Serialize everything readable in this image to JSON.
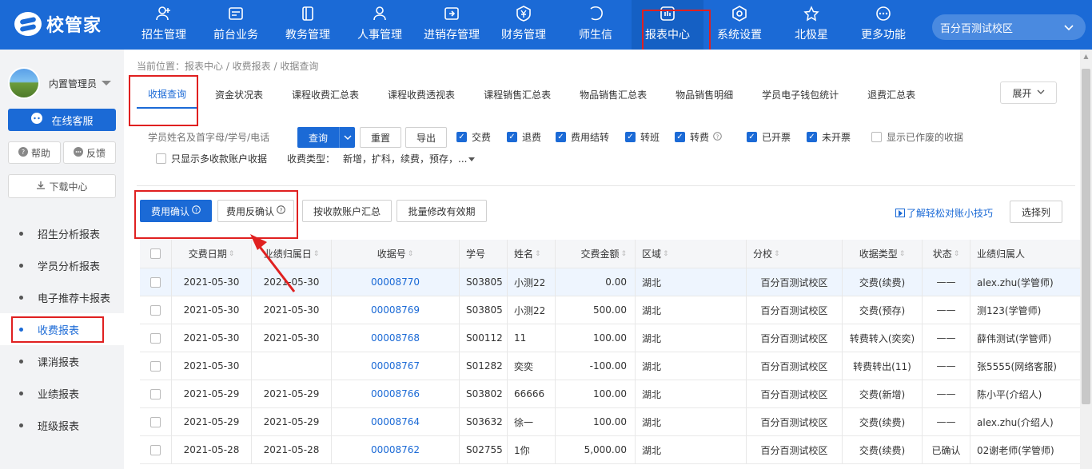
{
  "brand": {
    "name": "校管家"
  },
  "nav": [
    {
      "label": "招生管理",
      "icon": "user-plus-icon"
    },
    {
      "label": "前台业务",
      "icon": "desk-icon"
    },
    {
      "label": "教务管理",
      "icon": "book-icon"
    },
    {
      "label": "人事管理",
      "icon": "person-icon"
    },
    {
      "label": "进销存管理",
      "icon": "inventory-icon"
    },
    {
      "label": "财务管理",
      "icon": "yen-icon"
    },
    {
      "label": "师生信",
      "icon": "chat-icon"
    },
    {
      "label": "报表中心",
      "icon": "chart-icon"
    },
    {
      "label": "系统设置",
      "icon": "gear-icon"
    },
    {
      "label": "北极星",
      "icon": "star-icon"
    },
    {
      "label": "更多功能",
      "icon": "more-icon"
    }
  ],
  "campus": {
    "label": "百分百测试校区"
  },
  "sidebar": {
    "user": "内置管理员",
    "service": "在线客服",
    "help": "帮助",
    "feedback": "反馈",
    "download": "下载中心",
    "items": [
      "招生分析报表",
      "学员分析报表",
      "电子推荐卡报表",
      "收费报表",
      "课消报表",
      "业绩报表",
      "班级报表"
    ]
  },
  "main": {
    "breadcrumb": "当前位置：报表中心 / 收费报表 / 收据查询",
    "tabs": [
      "收据查询",
      "资金状况表",
      "课程收费汇总表",
      "课程收费透视表",
      "课程销售汇总表",
      "物品销售汇总表",
      "物品销售明细",
      "学员电子钱包统计",
      "退费汇总表"
    ],
    "expand": "展开"
  },
  "filters": {
    "search_placeholder": "学员姓名及首字母/学号/电话",
    "query": "查询",
    "reset": "重置",
    "export": "导出",
    "checks": [
      "交费",
      "退费",
      "费用结转",
      "转班",
      "转费",
      "已开票",
      "未开票",
      "显示已作废的收据"
    ],
    "only_multi": "只显示多收款账户收据",
    "fee_type_label": "收费类型：",
    "fee_type_value": "新增，扩科，续费，预存，..."
  },
  "actions": {
    "confirm": "费用确认",
    "unconfirm": "费用反确认",
    "by_account": "按收款账户汇总",
    "batch": "批量修改有效期",
    "tip": "了解轻松对账小技巧",
    "columns": "选择列"
  },
  "table": {
    "headers": [
      "交费日期",
      "业绩归属日",
      "收据号",
      "学号",
      "姓名",
      "交费金额",
      "区域",
      "分校",
      "收据类型",
      "状态",
      "业绩归属人"
    ],
    "rows": [
      [
        "2021-05-30",
        "2021-05-30",
        "00008770",
        "S03805",
        "小测22",
        "0.00",
        "湖北",
        "百分百测试校区",
        "交费(续费)",
        "——",
        "alex.zhu(学管师)"
      ],
      [
        "2021-05-30",
        "2021-05-30",
        "00008769",
        "S03805",
        "小测22",
        "500.00",
        "湖北",
        "百分百测试校区",
        "交费(预存)",
        "——",
        "测123(学管师)"
      ],
      [
        "2021-05-30",
        "2021-05-30",
        "00008768",
        "S00112",
        "11",
        "100.00",
        "湖北",
        "百分百测试校区",
        "转费转入(奕奕)",
        "——",
        "薛伟测试(学管师)"
      ],
      [
        "2021-05-30",
        "",
        "00008767",
        "S01282",
        "奕奕",
        "-100.00",
        "湖北",
        "百分百测试校区",
        "转费转出(11)",
        "——",
        "张5555(网络客服)"
      ],
      [
        "2021-05-29",
        "2021-05-29",
        "00008766",
        "S03802",
        "66666",
        "100.00",
        "湖北",
        "百分百测试校区",
        "交费(新增)",
        "——",
        "陈小平(介绍人)"
      ],
      [
        "2021-05-29",
        "2021-05-29",
        "00008764",
        "S03632",
        "徐一",
        "100.00",
        "湖北",
        "百分百测试校区",
        "交费(续费)",
        "——",
        "alex.zhu(介绍人)"
      ],
      [
        "2021-05-28",
        "2021-05-28",
        "00008762",
        "S02755",
        "1你",
        "5,000.00",
        "湖北",
        "百分百测试校区",
        "交费(续费)",
        "已确认",
        "02谢老师(学管师)"
      ]
    ]
  }
}
